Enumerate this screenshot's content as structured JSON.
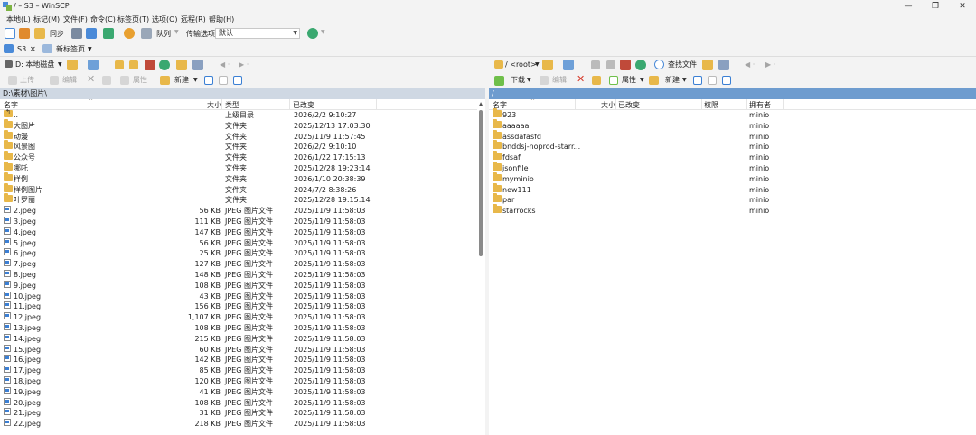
{
  "window": {
    "title": "/ – S3 – WinSCP",
    "minimize": "—",
    "maximize": "❐",
    "close": "✕"
  },
  "menu": [
    "本地(L)",
    "标记(M)",
    "文件(F)",
    "命令(C)",
    "标签页(T)",
    "选项(O)",
    "远程(R)",
    "帮助(H)"
  ],
  "toolbar": {
    "sync_label": "同步",
    "queue_label": "队列",
    "transfer_label": "传输选项",
    "transfer_value": "默认"
  },
  "tabs": {
    "session": "S3",
    "session_close": "✕",
    "new_tab": "新标签页"
  },
  "left": {
    "drive": "D: 本地磁盘",
    "upload": "上传",
    "edit": "编辑",
    "properties": "属性",
    "new": "新建",
    "path": "D:\\素材\\图片\\",
    "headers": {
      "name": "名字",
      "size": "大小",
      "type": "类型",
      "changed": "已改变"
    },
    "rows": [
      {
        "icon": "up",
        "name": "..",
        "size": "",
        "type": "上级目录",
        "changed": "2026/2/2 9:10:27"
      },
      {
        "icon": "folder",
        "name": "大图片",
        "size": "",
        "type": "文件夹",
        "changed": "2025/12/13 17:03:30"
      },
      {
        "icon": "folder",
        "name": "动漫",
        "size": "",
        "type": "文件夹",
        "changed": "2025/11/9 11:57:45"
      },
      {
        "icon": "folder",
        "name": "风景图",
        "size": "",
        "type": "文件夹",
        "changed": "2026/2/2 9:10:10"
      },
      {
        "icon": "folder",
        "name": "公众号",
        "size": "",
        "type": "文件夹",
        "changed": "2026/1/22 17:15:13"
      },
      {
        "icon": "folder",
        "name": "哪吒",
        "size": "",
        "type": "文件夹",
        "changed": "2025/12/28 19:23:14"
      },
      {
        "icon": "folder",
        "name": "样例",
        "size": "",
        "type": "文件夹",
        "changed": "2026/1/10 20:38:39"
      },
      {
        "icon": "folder",
        "name": "样例图片",
        "size": "",
        "type": "文件夹",
        "changed": "2024/7/2 8:38:26"
      },
      {
        "icon": "folder",
        "name": "叶罗丽",
        "size": "",
        "type": "文件夹",
        "changed": "2025/12/28 19:15:14"
      },
      {
        "icon": "image",
        "name": "2.jpeg",
        "size": "56 KB",
        "type": "JPEG 图片文件",
        "changed": "2025/11/9 11:58:03"
      },
      {
        "icon": "image",
        "name": "3.jpeg",
        "size": "111 KB",
        "type": "JPEG 图片文件",
        "changed": "2025/11/9 11:58:03"
      },
      {
        "icon": "image",
        "name": "4.jpeg",
        "size": "147 KB",
        "type": "JPEG 图片文件",
        "changed": "2025/11/9 11:58:03"
      },
      {
        "icon": "image",
        "name": "5.jpeg",
        "size": "56 KB",
        "type": "JPEG 图片文件",
        "changed": "2025/11/9 11:58:03"
      },
      {
        "icon": "image",
        "name": "6.jpeg",
        "size": "25 KB",
        "type": "JPEG 图片文件",
        "changed": "2025/11/9 11:58:03"
      },
      {
        "icon": "image",
        "name": "7.jpeg",
        "size": "127 KB",
        "type": "JPEG 图片文件",
        "changed": "2025/11/9 11:58:03"
      },
      {
        "icon": "image",
        "name": "8.jpeg",
        "size": "148 KB",
        "type": "JPEG 图片文件",
        "changed": "2025/11/9 11:58:03"
      },
      {
        "icon": "image",
        "name": "9.jpeg",
        "size": "108 KB",
        "type": "JPEG 图片文件",
        "changed": "2025/11/9 11:58:03"
      },
      {
        "icon": "image",
        "name": "10.jpeg",
        "size": "43 KB",
        "type": "JPEG 图片文件",
        "changed": "2025/11/9 11:58:03"
      },
      {
        "icon": "image",
        "name": "11.jpeg",
        "size": "156 KB",
        "type": "JPEG 图片文件",
        "changed": "2025/11/9 11:58:03"
      },
      {
        "icon": "image",
        "name": "12.jpeg",
        "size": "1,107 KB",
        "type": "JPEG 图片文件",
        "changed": "2025/11/9 11:58:03"
      },
      {
        "icon": "image",
        "name": "13.jpeg",
        "size": "108 KB",
        "type": "JPEG 图片文件",
        "changed": "2025/11/9 11:58:03"
      },
      {
        "icon": "image",
        "name": "14.jpeg",
        "size": "215 KB",
        "type": "JPEG 图片文件",
        "changed": "2025/11/9 11:58:03"
      },
      {
        "icon": "image",
        "name": "15.jpeg",
        "size": "60 KB",
        "type": "JPEG 图片文件",
        "changed": "2025/11/9 11:58:03"
      },
      {
        "icon": "image",
        "name": "16.jpeg",
        "size": "142 KB",
        "type": "JPEG 图片文件",
        "changed": "2025/11/9 11:58:03"
      },
      {
        "icon": "image",
        "name": "17.jpeg",
        "size": "85 KB",
        "type": "JPEG 图片文件",
        "changed": "2025/11/9 11:58:03"
      },
      {
        "icon": "image",
        "name": "18.jpeg",
        "size": "120 KB",
        "type": "JPEG 图片文件",
        "changed": "2025/11/9 11:58:03"
      },
      {
        "icon": "image",
        "name": "19.jpeg",
        "size": "41 KB",
        "type": "JPEG 图片文件",
        "changed": "2025/11/9 11:58:03"
      },
      {
        "icon": "image",
        "name": "20.jpeg",
        "size": "108 KB",
        "type": "JPEG 图片文件",
        "changed": "2025/11/9 11:58:03"
      },
      {
        "icon": "image",
        "name": "21.jpeg",
        "size": "31 KB",
        "type": "JPEG 图片文件",
        "changed": "2025/11/9 11:58:03"
      },
      {
        "icon": "image",
        "name": "22.jpeg",
        "size": "218 KB",
        "type": "JPEG 图片文件",
        "changed": "2025/11/9 11:58:03"
      }
    ]
  },
  "right": {
    "drive": "/ <root>",
    "find": "查找文件",
    "download": "下载",
    "edit": "编辑",
    "properties": "属性",
    "new": "新建",
    "path": "/",
    "headers": {
      "name": "名字",
      "size": "大小",
      "changed": "已改变",
      "rights": "权限",
      "owner": "拥有者"
    },
    "rows": [
      {
        "name": "923",
        "owner": "minio"
      },
      {
        "name": "aaaaaa",
        "owner": "minio"
      },
      {
        "name": "assdafasfd",
        "owner": "minio"
      },
      {
        "name": "bnddsj-noprod-starr...",
        "owner": "minio"
      },
      {
        "name": "fdsaf",
        "owner": "minio"
      },
      {
        "name": "jsonfile",
        "owner": "minio"
      },
      {
        "name": "myminio",
        "owner": "minio"
      },
      {
        "name": "new111",
        "owner": "minio"
      },
      {
        "name": "par",
        "owner": "minio"
      },
      {
        "name": "starrocks",
        "owner": "minio"
      }
    ]
  }
}
